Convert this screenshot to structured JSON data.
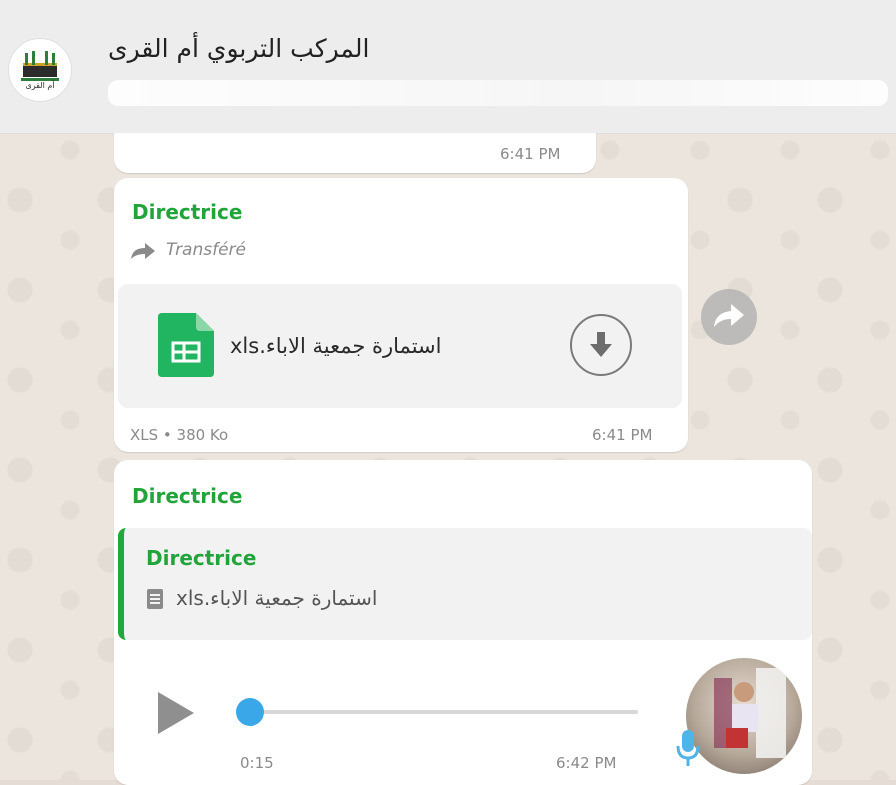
{
  "header": {
    "group_name": "المركب التربوي أم القرى",
    "avatar_label": "أم القرى"
  },
  "messages": [
    {
      "type": "partial",
      "time": "6:41 PM"
    },
    {
      "type": "forwarded_document",
      "sender": "Directrice",
      "forwarded_label": "Transféré",
      "file_name": "استمارة جمعية الاباء.xls",
      "file_meta": "XLS • 380 Ko",
      "time": "6:41 PM"
    },
    {
      "type": "voice_reply",
      "sender": "Directrice",
      "quoted_sender": "Directrice",
      "quoted_file": "استمارة جمعية الاباء.xls",
      "duration": "0:15",
      "progress": 0.0,
      "time": "6:42 PM"
    }
  ],
  "colors": {
    "accent_green": "#22a43a",
    "quote_bar": "#1faa3a",
    "mic_blue": "#4fb5e8"
  },
  "icons": {
    "forward": "forward-arrow-icon",
    "spreadsheet": "spreadsheet-file-icon",
    "download": "download-arrow-icon",
    "share": "share-forward-icon",
    "document": "document-icon",
    "play": "play-icon",
    "microphone": "microphone-icon"
  }
}
